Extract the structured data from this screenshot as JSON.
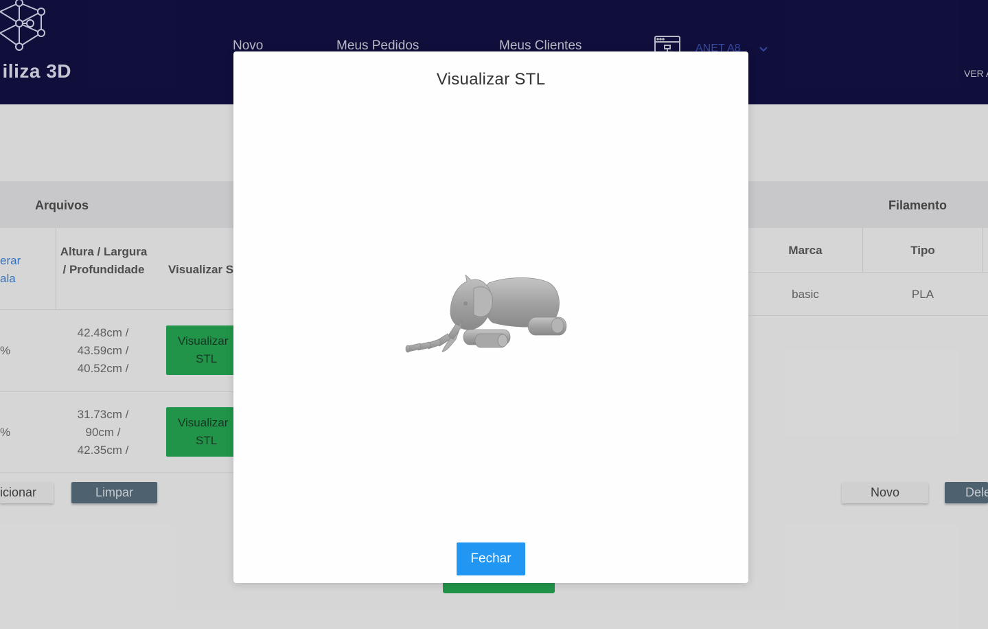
{
  "header": {
    "brand": "iliza 3D",
    "nav": [
      "Novo",
      "Meus Pedidos",
      "Meus Clientes"
    ],
    "printer_selected": "ANET A8",
    "ver_link": "VER A"
  },
  "files_section": {
    "title": "Arquivos",
    "link_lines": [
      "erar",
      "ala"
    ],
    "col_dimensions": "Altura / Largura / Profundidade",
    "col_view": "Visualizar STL",
    "rows": [
      {
        "pct": "%",
        "dims": [
          "42.48cm /",
          "43.59cm /",
          "40.52cm /"
        ],
        "button": [
          "Visualizar",
          "STL"
        ]
      },
      {
        "pct": "%",
        "dims": [
          "31.73cm /",
          "90cm /",
          "42.35cm /"
        ],
        "button": [
          "Visualizar",
          "STL"
        ]
      }
    ],
    "buttons": {
      "add": "icionar",
      "clear": "Limpar"
    }
  },
  "filament_section": {
    "title": "Filamento",
    "col_brand": "Marca",
    "col_type": "Tipo",
    "row": {
      "brand": "basic",
      "type": "PLA"
    },
    "buttons": {
      "new": "Novo",
      "delete": "Dele"
    }
  },
  "modal": {
    "title": "Visualizar STL",
    "close_label": "Fechar"
  },
  "colors": {
    "header_bg": "#121040",
    "primary_button": "#2196f3",
    "success_button": "#24a150"
  }
}
